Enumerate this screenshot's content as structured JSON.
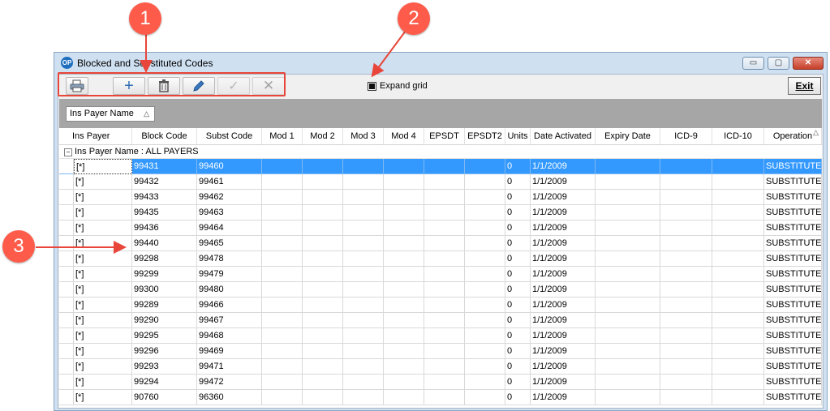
{
  "window": {
    "title": "Blocked and Substituted Codes",
    "app_icon": "OP",
    "controls": {
      "minimize": "▭",
      "maximize": "▢",
      "close": "✕"
    }
  },
  "toolbar": {
    "buttons": [
      {
        "name": "print-icon",
        "enabled": true
      },
      {
        "name": "add-icon",
        "glyph": "+",
        "enabled": true
      },
      {
        "name": "delete-icon",
        "enabled": true
      },
      {
        "name": "edit-icon",
        "enabled": true
      },
      {
        "name": "checkmark-icon",
        "glyph": "✓",
        "enabled": false
      },
      {
        "name": "cancel-icon",
        "glyph": "✕",
        "enabled": false
      }
    ],
    "expand_grid_label": "Expand grid",
    "expand_grid_checked": true,
    "exit_label": "Exit"
  },
  "group_panel": {
    "chip_label": "Ins Payer Name",
    "sort_glyph": "△"
  },
  "grid": {
    "columns": [
      "Ins Payer",
      "Block Code",
      "Subst Code",
      "Mod 1",
      "Mod 2",
      "Mod 3",
      "Mod 4",
      "EPSDT",
      "EPSDT2",
      "Units",
      "Date Activated",
      "Expiry Date",
      "ICD-9",
      "ICD-10",
      "Operation"
    ],
    "sort_glyph": "△",
    "group_label": "Ins Payer Name : ALL PAYERS",
    "collapse_glyph": "−",
    "rows": [
      [
        "[*]",
        "99431",
        "99460",
        "",
        "",
        "",
        "",
        "",
        "",
        "0",
        "1/1/2009",
        "",
        "",
        "",
        "SUBSTITUTE"
      ],
      [
        "[*]",
        "99432",
        "99461",
        "",
        "",
        "",
        "",
        "",
        "",
        "0",
        "1/1/2009",
        "",
        "",
        "",
        "SUBSTITUTE"
      ],
      [
        "[*]",
        "99433",
        "99462",
        "",
        "",
        "",
        "",
        "",
        "",
        "0",
        "1/1/2009",
        "",
        "",
        "",
        "SUBSTITUTE"
      ],
      [
        "[*]",
        "99435",
        "99463",
        "",
        "",
        "",
        "",
        "",
        "",
        "0",
        "1/1/2009",
        "",
        "",
        "",
        "SUBSTITUTE"
      ],
      [
        "[*]",
        "99436",
        "99464",
        "",
        "",
        "",
        "",
        "",
        "",
        "0",
        "1/1/2009",
        "",
        "",
        "",
        "SUBSTITUTE"
      ],
      [
        "[*]",
        "99440",
        "99465",
        "",
        "",
        "",
        "",
        "",
        "",
        "0",
        "1/1/2009",
        "",
        "",
        "",
        "SUBSTITUTE"
      ],
      [
        "[*]",
        "99298",
        "99478",
        "",
        "",
        "",
        "",
        "",
        "",
        "0",
        "1/1/2009",
        "",
        "",
        "",
        "SUBSTITUTE"
      ],
      [
        "[*]",
        "99299",
        "99479",
        "",
        "",
        "",
        "",
        "",
        "",
        "0",
        "1/1/2009",
        "",
        "",
        "",
        "SUBSTITUTE"
      ],
      [
        "[*]",
        "99300",
        "99480",
        "",
        "",
        "",
        "",
        "",
        "",
        "0",
        "1/1/2009",
        "",
        "",
        "",
        "SUBSTITUTE"
      ],
      [
        "[*]",
        "99289",
        "99466",
        "",
        "",
        "",
        "",
        "",
        "",
        "0",
        "1/1/2009",
        "",
        "",
        "",
        "SUBSTITUTE"
      ],
      [
        "[*]",
        "99290",
        "99467",
        "",
        "",
        "",
        "",
        "",
        "",
        "0",
        "1/1/2009",
        "",
        "",
        "",
        "SUBSTITUTE"
      ],
      [
        "[*]",
        "99295",
        "99468",
        "",
        "",
        "",
        "",
        "",
        "",
        "0",
        "1/1/2009",
        "",
        "",
        "",
        "SUBSTITUTE"
      ],
      [
        "[*]",
        "99296",
        "99469",
        "",
        "",
        "",
        "",
        "",
        "",
        "0",
        "1/1/2009",
        "",
        "",
        "",
        "SUBSTITUTE"
      ],
      [
        "[*]",
        "99293",
        "99471",
        "",
        "",
        "",
        "",
        "",
        "",
        "0",
        "1/1/2009",
        "",
        "",
        "",
        "SUBSTITUTE"
      ],
      [
        "[*]",
        "99294",
        "99472",
        "",
        "",
        "",
        "",
        "",
        "",
        "0",
        "1/1/2009",
        "",
        "",
        "",
        "SUBSTITUTE"
      ],
      [
        "[*]",
        "90760",
        "96360",
        "",
        "",
        "",
        "",
        "",
        "",
        "0",
        "1/1/2009",
        "",
        "",
        "",
        "SUBSTITUTE"
      ]
    ],
    "selected_row": 0
  },
  "callouts": [
    "1",
    "2",
    "3"
  ],
  "colors": {
    "callout": "#ff5b4a",
    "selection": "#3399ff",
    "window_frame": "#cfe0f1"
  }
}
